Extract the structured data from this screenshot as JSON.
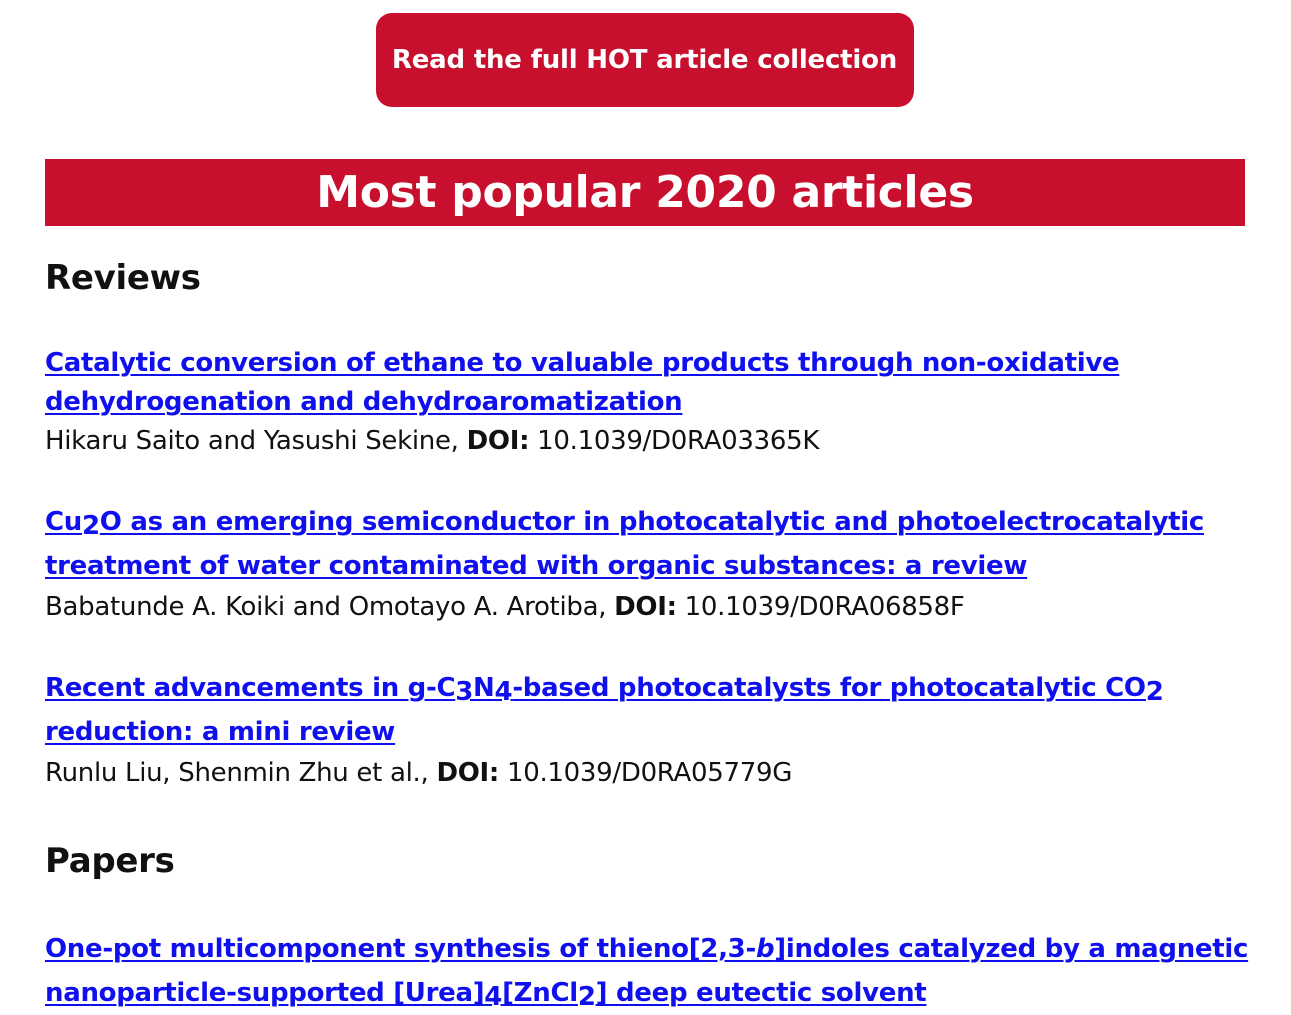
{
  "cta": {
    "label": "Read the full HOT article collection",
    "color": "#c8102e"
  },
  "banner": {
    "title": "Most popular 2020 articles",
    "color": "#c8102e"
  },
  "link_color": "#1010ee",
  "sections": [
    {
      "heading": "Reviews",
      "articles": [
        {
          "title": "Catalytic conversion of ethane to valuable products through non-oxidative dehydrogenation and dehydroaromatization",
          "authors": "Hikaru Saito and Yasushi Sekine,",
          "doi_label": "DOI:",
          "doi": "10.1039/D0RA03365K"
        },
        {
          "title_parts": [
            "Cu",
            "2",
            "O as an emerging semiconductor in photocatalytic and photoelectrocatalytic treatment of water contaminated with organic substances: a review"
          ],
          "authors": "Babatunde A. Koiki and Omotayo A. Arotiba,",
          "doi_label": "DOI:",
          "doi": "10.1039/D0RA06858F"
        },
        {
          "title_parts": [
            "Recent advancements in g-C",
            "3",
            "N",
            "4",
            "-based photocatalysts for photocatalytic CO",
            "2",
            " reduction: a mini review"
          ],
          "authors": "Runlu Liu, Shenmin Zhu et al.,",
          "doi_label": "DOI:",
          "doi": "10.1039/D0RA05779G"
        }
      ]
    },
    {
      "heading": "Papers",
      "articles": [
        {
          "title_parts": [
            "One-pot multicomponent synthesis of thieno[2,3-",
            "b",
            "]indoles catalyzed by a magnetic nanoparticle-supported [Urea]",
            "4",
            "[ZnCl",
            "2",
            "] deep eutectic solvent"
          ]
        }
      ]
    }
  ]
}
